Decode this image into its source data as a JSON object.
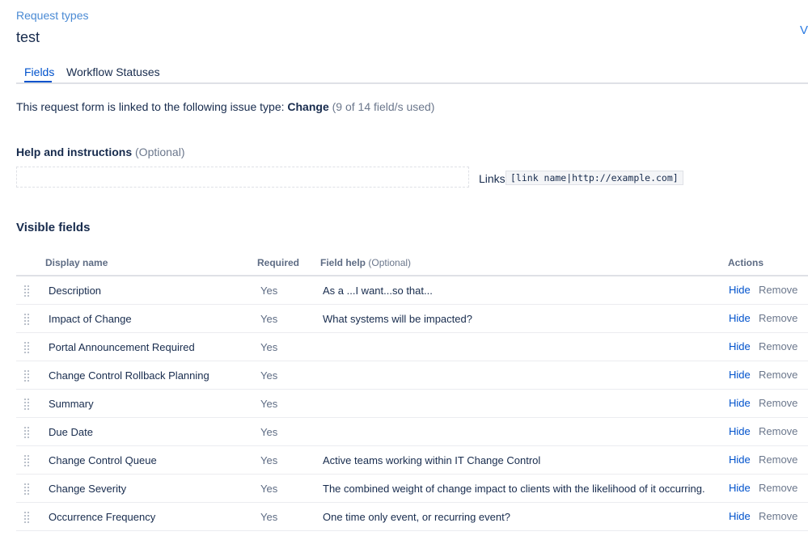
{
  "breadcrumb": "Request types",
  "title": "test",
  "edge_link": "Vi",
  "tabs": [
    {
      "label": "Fields",
      "active": true
    },
    {
      "label": "Workflow Statuses",
      "active": false
    }
  ],
  "issue_line": {
    "prefix": "This request form is linked to the following issue type:",
    "issue_type": "Change",
    "usage": "(9 of 14 field/s used)"
  },
  "help": {
    "label": "Help and instructions",
    "optional": "(Optional)",
    "value": "",
    "links_label": "Links",
    "links_code": "[link name|http://example.com]"
  },
  "visible_fields": {
    "title": "Visible fields",
    "columns": {
      "display_name": "Display name",
      "required": "Required",
      "field_help": "Field help",
      "field_help_optional": "(Optional)",
      "actions": "Actions"
    },
    "rows": [
      {
        "name": "Description",
        "required": "Yes",
        "help": "As a ...I want...so that..."
      },
      {
        "name": "Impact of Change",
        "required": "Yes",
        "help": "What systems will be impacted?"
      },
      {
        "name": "Portal Announcement Required",
        "required": "Yes",
        "help": ""
      },
      {
        "name": "Change Control Rollback Planning",
        "required": "Yes",
        "help": ""
      },
      {
        "name": "Summary",
        "required": "Yes",
        "help": ""
      },
      {
        "name": "Due Date",
        "required": "Yes",
        "help": ""
      },
      {
        "name": "Change Control Queue",
        "required": "Yes",
        "help": "Active teams working within IT Change Control"
      },
      {
        "name": "Change Severity",
        "required": "Yes",
        "help": "The combined weight of change impact to clients with the likelihood of it occurring."
      },
      {
        "name": "Occurrence Frequency",
        "required": "Yes",
        "help": "One time only event, or recurring event?"
      }
    ],
    "hide_label": "Hide",
    "remove_label": "Remove"
  },
  "colors": {
    "accent": "#0052cc",
    "breadcrumb": "#4a8ad4",
    "muted": "#6b778c",
    "text": "#172b4d"
  },
  "icons": {
    "row_handle": "drag-handle-icon"
  }
}
